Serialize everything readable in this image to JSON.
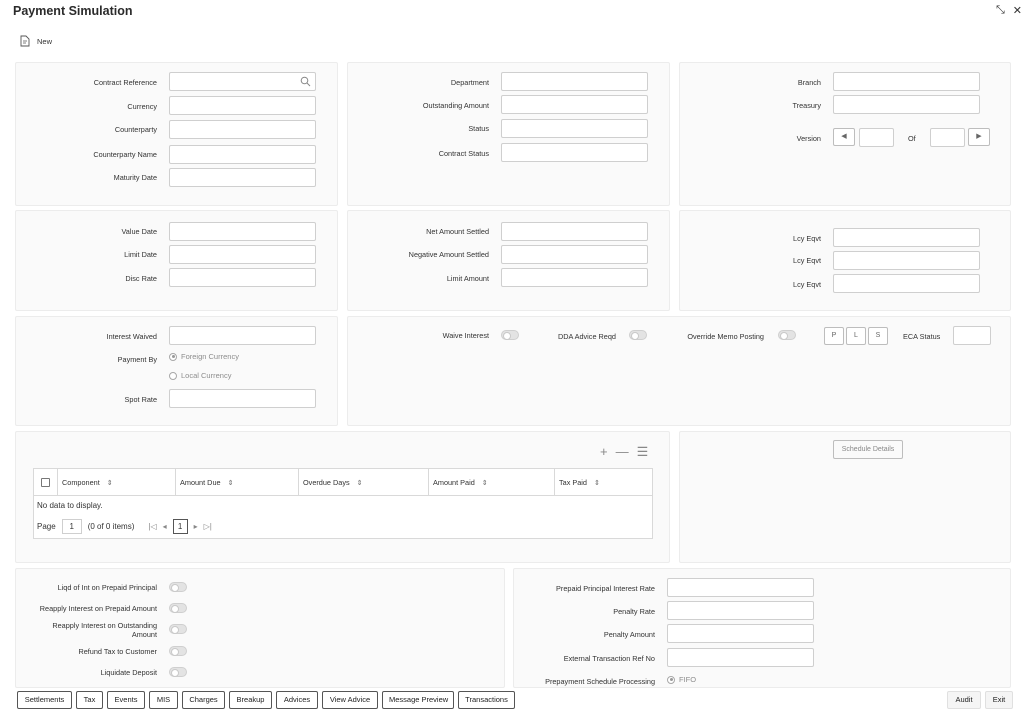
{
  "header": {
    "title": "Payment Simulation",
    "expand_icon": "⤡",
    "close_icon": "✕"
  },
  "toolbar": {
    "new_label": "New"
  },
  "section1": {
    "left": {
      "contract_reference": "Contract Reference",
      "currency": "Currency",
      "counterparty": "Counterparty",
      "counterparty_name": "Counterparty Name",
      "maturity_date": "Maturity Date"
    },
    "mid": {
      "department": "Department",
      "outstanding_amount": "Outstanding Amount",
      "status": "Status",
      "contract_status": "Contract Status"
    },
    "right": {
      "branch": "Branch",
      "treasury": "Treasury",
      "version": "Version",
      "of": "Of"
    }
  },
  "section2": {
    "left": {
      "value_date": "Value Date",
      "limit_date": "Limit Date",
      "disc_rate": "Disc Rate"
    },
    "mid": {
      "net_amount_settled": "Net Amount Settled",
      "negative_amount_settled": "Negative Amount Settled",
      "limit_amount": "Limit Amount"
    },
    "right": {
      "lcy1": "Lcy Eqvt",
      "lcy2": "Lcy Eqvt",
      "lcy3": "Lcy Eqvt"
    }
  },
  "section3": {
    "interest_waived": "Interest Waived",
    "payment_by": "Payment By",
    "foreign_currency": "Foreign Currency",
    "local_currency": "Local Currency",
    "spot_rate": "Spot Rate",
    "waive_interest": "Waive Interest",
    "dda_advice_reqd": "DDA Advice Reqd",
    "override_memo_posting": "Override Memo Posting",
    "btn_p": "P",
    "btn_l": "L",
    "btn_s": "S",
    "eca_status": "ECA Status"
  },
  "grid": {
    "columns": [
      "Component",
      "Amount Due",
      "Overdue Days",
      "Amount Paid",
      "Tax Paid"
    ],
    "no_data": "No data to display.",
    "page_label": "Page",
    "page_value": "1",
    "items_text": "(0 of 0 items)",
    "current_page": "1",
    "add_icon": "+",
    "remove_icon": "—",
    "list_icon": "☰",
    "schedule_details": "Schedule Details"
  },
  "section4": {
    "left": {
      "liqd_int": "Liqd of Int on Prepaid Principal",
      "reapply_prepaid": "Reapply Interest on Prepaid Amount",
      "reapply_outstanding": "Reapply Interest on Outstanding Amount",
      "refund_tax": "Refund Tax to Customer",
      "liquidate_deposit": "Liquidate Deposit"
    },
    "right": {
      "prepaid_principal_rate": "Prepaid Principal Interest Rate",
      "penalty_rate": "Penalty Rate",
      "penalty_amount": "Penalty Amount",
      "external_ref": "External Transaction Ref No",
      "prepayment_schedule": "Prepayment Schedule Processing",
      "fifo": "FIFO"
    }
  },
  "footer": {
    "buttons": [
      "Settlements",
      "Tax",
      "Events",
      "MIS",
      "Charges",
      "Breakup",
      "Advices",
      "View Advice",
      "Message Preview",
      "Transactions"
    ],
    "audit": "Audit",
    "exit": "Exit"
  }
}
